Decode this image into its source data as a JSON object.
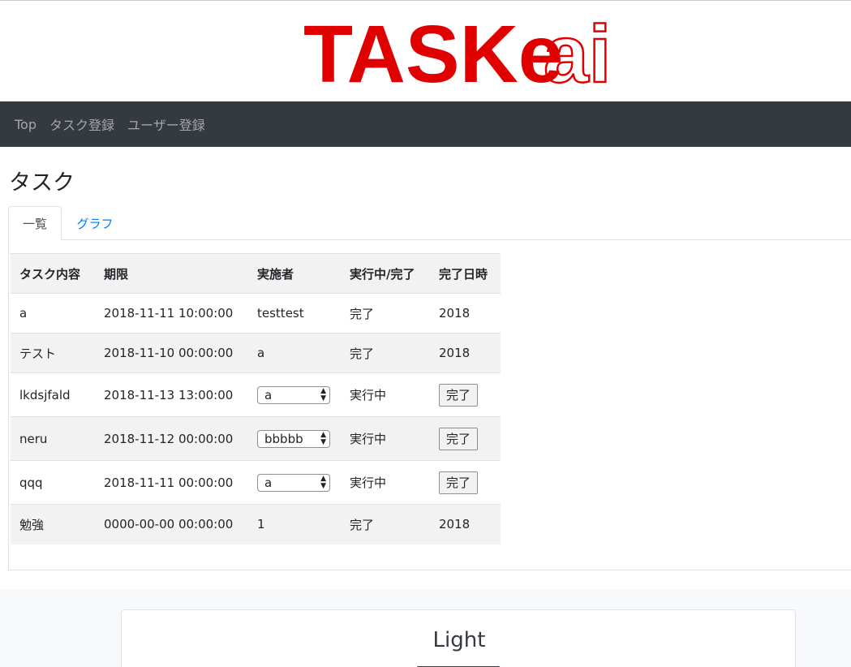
{
  "logo": {
    "text_red": "TASKe",
    "text_outline": "ai",
    "color": "#e00000"
  },
  "nav": {
    "items": [
      "Top",
      "タスク登録",
      "ユーザー登録"
    ]
  },
  "page": {
    "title": "タスク"
  },
  "tabs": [
    {
      "label": "一覧",
      "active": true
    },
    {
      "label": "グラフ",
      "active": false
    }
  ],
  "table": {
    "headers": [
      "タスク内容",
      "期限",
      "実施者",
      "実行中/完了",
      "完了日時"
    ],
    "rows": [
      {
        "task": "a",
        "deadline": "2018-11-11 10:00:00",
        "assignee": "testtest",
        "status": "完了",
        "completed": "2018"
      },
      {
        "task": "テスト",
        "deadline": "2018-11-10 00:00:00",
        "assignee": "a",
        "status": "完了",
        "completed": "2018"
      },
      {
        "task": "lkdsjfald",
        "deadline": "2018-11-13 13:00:00",
        "assignee": "a",
        "status": "実行中",
        "completed": "完了"
      },
      {
        "task": "neru",
        "deadline": "2018-11-12 00:00:00",
        "assignee": "bbbbb",
        "status": "実行中",
        "completed": "完了"
      },
      {
        "task": "qqq",
        "deadline": "2018-11-11 00:00:00",
        "assignee": "a",
        "status": "実行中",
        "completed": "完了"
      },
      {
        "task": "勉強",
        "deadline": "0000-00-00 00:00:00",
        "assignee": "1",
        "status": "完了",
        "completed": "2018"
      }
    ]
  },
  "footer": {
    "card_title": "Light"
  }
}
